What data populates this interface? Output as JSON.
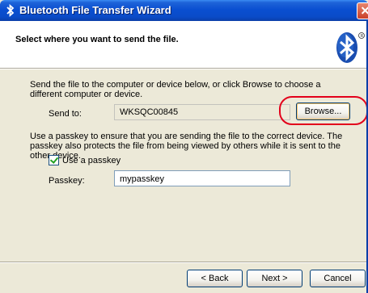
{
  "window": {
    "title": "Bluetooth File Transfer Wizard",
    "icons": {
      "title_icon": "bluetooth-icon",
      "header_logo": "bluetooth-logo-icon",
      "close": "close-icon"
    }
  },
  "header": {
    "title": "Select where you want to send the file."
  },
  "body": {
    "intro_text": "Send the file to the computer or device below, or click Browse to choose a different computer or device.",
    "send_to_label": "Send to:",
    "send_to_value": "WKSQC00845",
    "browse_label": "Browse...",
    "passkey_info": "Use a passkey to ensure that you are sending the file to the correct device. The passkey also protects the file from being viewed by others while it is sent to the other device.",
    "use_passkey_label": "Use a passkey",
    "use_passkey_checked": true,
    "passkey_label": "Passkey:",
    "passkey_value": "mypasskey"
  },
  "footer": {
    "back_label": "< Back",
    "next_label": "Next >",
    "cancel_label": "Cancel"
  },
  "colors": {
    "titlebar": "#0a4fd1",
    "highlight": "#e3001b",
    "dialog_bg": "#ece9d8"
  }
}
